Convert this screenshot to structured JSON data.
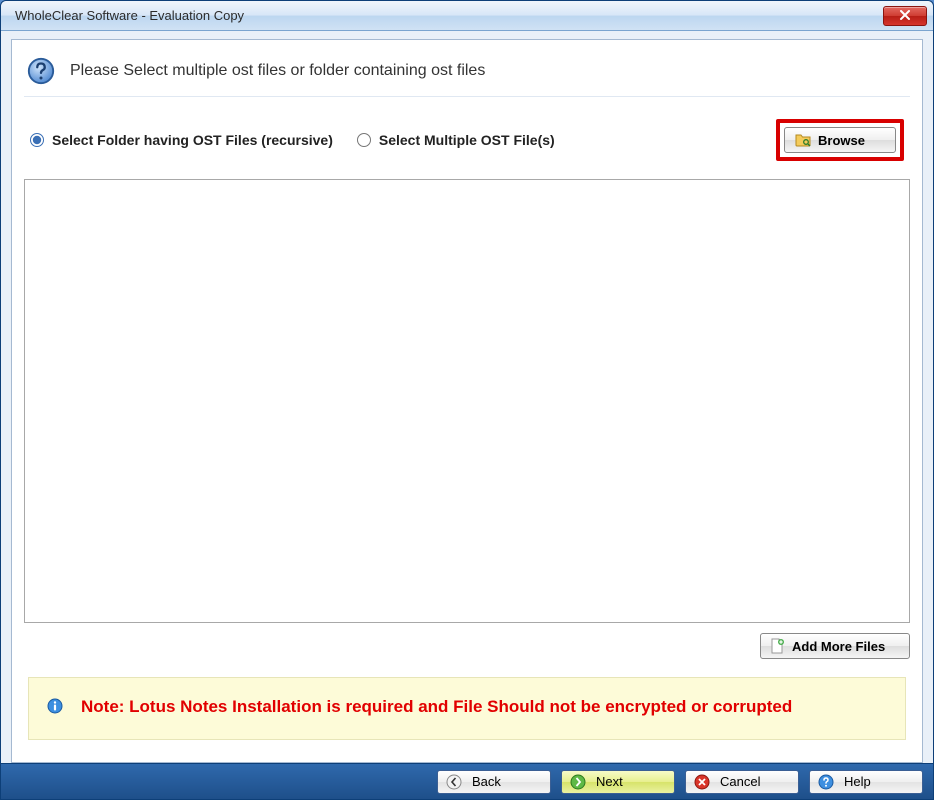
{
  "window": {
    "title": "WholeClear Software - Evaluation Copy"
  },
  "header": {
    "instruction": "Please Select multiple ost files or folder containing ost files"
  },
  "options": {
    "folder_label": "Select Folder having OST Files (recursive)",
    "multiple_label": "Select Multiple OST File(s)",
    "browse_label": "Browse"
  },
  "buttons": {
    "add_more_label": "Add More Files"
  },
  "note": {
    "text": "Note: Lotus Notes Installation is required and File Should not be encrypted or corrupted"
  },
  "footer": {
    "back_label": "Back",
    "next_label": "Next",
    "cancel_label": "Cancel",
    "help_label": "Help"
  }
}
